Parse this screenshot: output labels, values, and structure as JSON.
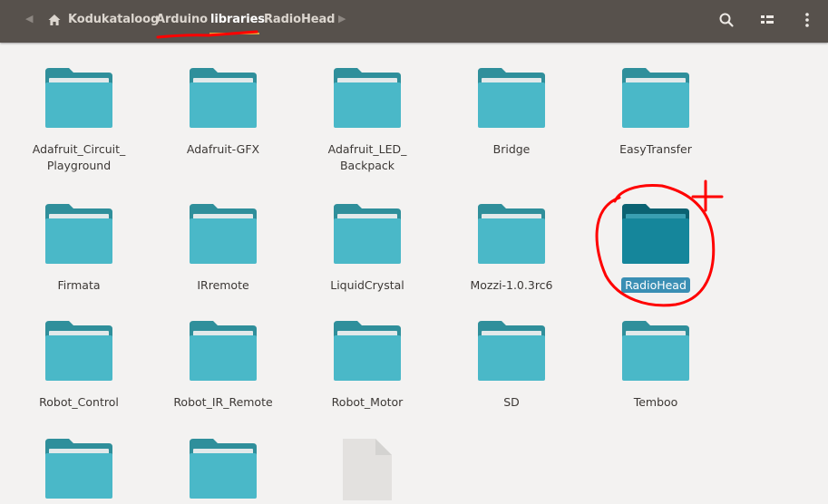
{
  "header": {
    "back_icon": "chevron-left-icon",
    "forward_icon": "chevron-right-icon",
    "home_icon": "home-icon",
    "breadcrumb": [
      "Kodukataloog",
      "Arduino",
      "libraries",
      "RadioHead"
    ],
    "current_index": 2,
    "search_icon": "search-icon",
    "view_icon": "view-options-icon",
    "menu_icon": "kebab-menu-icon"
  },
  "colors": {
    "header_bg": "#57514c",
    "folder_body": "#4ab8c8",
    "folder_tab": "#2f8f9b",
    "folder_selected_body": "#15869b",
    "folder_selected_tab": "#0b6272",
    "selection_bg": "#3a8fb4",
    "current_underline": "#dba73c",
    "annotation_red": "#ff0000"
  },
  "files": [
    {
      "name": "Adafruit_Circuit_\nPlayground",
      "lines": [
        "Adafruit_Circuit_",
        "Playground"
      ],
      "type": "folder",
      "selected": false
    },
    {
      "name": "Adafruit-GFX",
      "lines": [
        "Adafruit-GFX"
      ],
      "type": "folder",
      "selected": false
    },
    {
      "name": "Adafruit_LED_\nBackpack",
      "lines": [
        "Adafruit_LED_",
        "Backpack"
      ],
      "type": "folder",
      "selected": false
    },
    {
      "name": "Bridge",
      "lines": [
        "Bridge"
      ],
      "type": "folder",
      "selected": false
    },
    {
      "name": "EasyTransfer",
      "lines": [
        "EasyTransfer"
      ],
      "type": "folder",
      "selected": false
    },
    {
      "name": "Firmata",
      "lines": [
        "Firmata"
      ],
      "type": "folder",
      "selected": false
    },
    {
      "name": "IRremote",
      "lines": [
        "IRremote"
      ],
      "type": "folder",
      "selected": false
    },
    {
      "name": "LiquidCrystal",
      "lines": [
        "LiquidCrystal"
      ],
      "type": "folder",
      "selected": false
    },
    {
      "name": "Mozzi-1.0.3rc6",
      "lines": [
        "Mozzi-1.0.3rc6"
      ],
      "type": "folder",
      "selected": false
    },
    {
      "name": "RadioHead",
      "lines": [
        "RadioHead"
      ],
      "type": "folder",
      "selected": true
    },
    {
      "name": "Robot_Control",
      "lines": [
        "Robot_Control"
      ],
      "type": "folder",
      "selected": false
    },
    {
      "name": "Robot_IR_Remote",
      "lines": [
        "Robot_IR_Remote"
      ],
      "type": "folder",
      "selected": false
    },
    {
      "name": "Robot_Motor",
      "lines": [
        "Robot_Motor"
      ],
      "type": "folder",
      "selected": false
    },
    {
      "name": "SD",
      "lines": [
        "SD"
      ],
      "type": "folder",
      "selected": false
    },
    {
      "name": "Temboo",
      "lines": [
        "Temboo"
      ],
      "type": "folder",
      "selected": false
    },
    {
      "name": "",
      "lines": [],
      "type": "folder",
      "selected": false
    },
    {
      "name": "",
      "lines": [],
      "type": "folder",
      "selected": false
    },
    {
      "name": "",
      "lines": [],
      "type": "file",
      "selected": false
    }
  ]
}
